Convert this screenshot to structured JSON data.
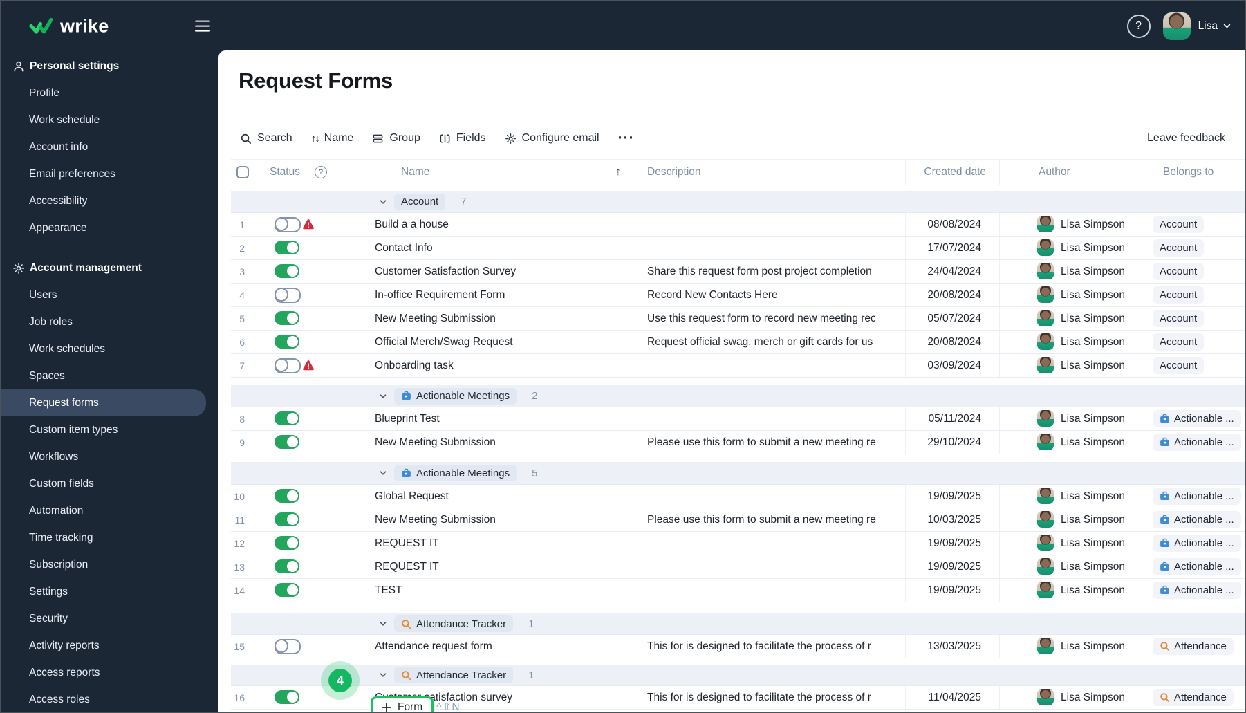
{
  "topbar": {
    "logo_text": "wrike",
    "help_glyph": "?",
    "user_name": "Lisa"
  },
  "sidebar": {
    "sections": [
      {
        "label": "Personal settings",
        "icon": "person",
        "items": [
          "Profile",
          "Work schedule",
          "Account info",
          "Email preferences",
          "Accessibility",
          "Appearance"
        ],
        "selected": null
      },
      {
        "label": "Account management",
        "icon": "gear",
        "items": [
          "Users",
          "Job roles",
          "Work schedules",
          "Spaces",
          "Request forms",
          "Custom item types",
          "Workflows",
          "Custom fields",
          "Automation",
          "Time tracking",
          "Subscription",
          "Settings",
          "Security",
          "Activity reports",
          "Access reports",
          "Access roles"
        ],
        "selected": "Request forms"
      }
    ]
  },
  "page": {
    "title": "Request Forms"
  },
  "toolbar": {
    "search_label": "Search",
    "sort_label": "Name",
    "group_label": "Group",
    "fields_label": "Fields",
    "configure_email_label": "Configure email",
    "more_label": "···",
    "leave_feedback_label": "Leave feedback",
    "sort_glyph": "↑↓"
  },
  "table": {
    "headers": {
      "status": "Status",
      "status_help": "?",
      "name": "Name",
      "description": "Description",
      "created": "Created date",
      "author": "Author",
      "belongs": "Belongs to"
    },
    "groups": [
      {
        "label": "Account",
        "count": "7",
        "icon": null,
        "rows": [
          {
            "num": "1",
            "toggle": "off",
            "warning": true,
            "name": "Build a a house",
            "description": "",
            "date": "08/08/2024",
            "author": "Lisa Simpson",
            "belongs": {
              "label": "Account",
              "icon": null
            }
          },
          {
            "num": "2",
            "toggle": "on",
            "warning": false,
            "name": "Contact Info",
            "description": "",
            "date": "17/07/2024",
            "author": "Lisa Simpson",
            "belongs": {
              "label": "Account",
              "icon": null
            }
          },
          {
            "num": "3",
            "toggle": "on",
            "warning": false,
            "name": "Customer Satisfaction Survey",
            "description": "Share this request form post project completion",
            "date": "24/04/2024",
            "author": "Lisa Simpson",
            "belongs": {
              "label": "Account",
              "icon": null
            }
          },
          {
            "num": "4",
            "toggle": "off",
            "warning": false,
            "name": "In-office Requirement Form",
            "description": "Record New Contacts Here",
            "date": "20/08/2024",
            "author": "Lisa Simpson",
            "belongs": {
              "label": "Account",
              "icon": null
            }
          },
          {
            "num": "5",
            "toggle": "on",
            "warning": false,
            "name": "New Meeting Submission",
            "description": "Use this request form to record new meeting rec",
            "date": "05/07/2024",
            "author": "Lisa Simpson",
            "belongs": {
              "label": "Account",
              "icon": null
            }
          },
          {
            "num": "6",
            "toggle": "on",
            "warning": false,
            "name": "Official Merch/Swag Request",
            "description": "Request official swag, merch or gift cards for us",
            "date": "20/08/2024",
            "author": "Lisa Simpson",
            "belongs": {
              "label": "Account",
              "icon": null
            }
          },
          {
            "num": "7",
            "toggle": "off",
            "warning": true,
            "name": "Onboarding task",
            "description": "",
            "date": "03/09/2024",
            "author": "Lisa Simpson",
            "belongs": {
              "label": "Account",
              "icon": null
            }
          }
        ]
      },
      {
        "label": "Actionable Meetings",
        "count": "2",
        "icon": "briefcase",
        "rows": [
          {
            "num": "8",
            "toggle": "on",
            "warning": false,
            "name": "Blueprint Test",
            "description": "",
            "date": "05/11/2024",
            "author": "Lisa Simpson",
            "belongs": {
              "label": "Actionable ...",
              "icon": "briefcase"
            }
          },
          {
            "num": "9",
            "toggle": "on",
            "warning": false,
            "name": "New Meeting Submission",
            "description": "Please use this form to submit a new meeting re",
            "date": "29/10/2024",
            "author": "Lisa Simpson",
            "belongs": {
              "label": "Actionable ...",
              "icon": "briefcase"
            }
          }
        ]
      },
      {
        "label": "Actionable Meetings",
        "count": "5",
        "icon": "briefcase",
        "rows": [
          {
            "num": "10",
            "toggle": "on",
            "warning": false,
            "name": "Global Request",
            "description": "",
            "date": "19/09/2025",
            "author": "Lisa Simpson",
            "belongs": {
              "label": "Actionable ...",
              "icon": "briefcase"
            }
          },
          {
            "num": "11",
            "toggle": "on",
            "warning": false,
            "name": "New Meeting Submission",
            "description": "Please use this form to submit a new meeting re",
            "date": "10/03/2025",
            "author": "Lisa Simpson",
            "belongs": {
              "label": "Actionable ...",
              "icon": "briefcase"
            }
          },
          {
            "num": "12",
            "toggle": "on",
            "warning": false,
            "name": "REQUEST IT",
            "description": "",
            "date": "19/09/2025",
            "author": "Lisa Simpson",
            "belongs": {
              "label": "Actionable ...",
              "icon": "briefcase"
            }
          },
          {
            "num": "13",
            "toggle": "on",
            "warning": false,
            "name": "REQUEST IT",
            "description": "",
            "date": "19/09/2025",
            "author": "Lisa Simpson",
            "belongs": {
              "label": "Actionable ...",
              "icon": "briefcase"
            }
          },
          {
            "num": "14",
            "toggle": "on",
            "warning": false,
            "name": "TEST",
            "description": "",
            "date": "19/09/2025",
            "author": "Lisa Simpson",
            "belongs": {
              "label": "Actionable ...",
              "icon": "briefcase"
            }
          }
        ]
      },
      {
        "label": "Attendance Tracker",
        "count": "1",
        "icon": "magnifier",
        "rows": [
          {
            "num": "15",
            "toggle": "off",
            "warning": false,
            "name": "Attendance request form",
            "description": "This for is designed to facilitate the process of r",
            "date": "13/03/2025",
            "author": "Lisa Simpson",
            "belongs": {
              "label": "Attendance",
              "icon": "magnifier"
            }
          }
        ]
      },
      {
        "label": "Attendance Tracker",
        "count": "1",
        "icon": "magnifier",
        "rows": [
          {
            "num": "16",
            "toggle": "on",
            "warning": false,
            "name": "Customer satisfaction survey",
            "description": "This for is designed to facilitate the process of r",
            "date": "11/04/2025",
            "author": "Lisa Simpson",
            "belongs": {
              "label": "Attendance",
              "icon": "magnifier"
            }
          }
        ]
      }
    ]
  },
  "footer": {
    "marker_count": "4",
    "form_label": "Form",
    "shortcut_hint": "^⇧N"
  },
  "colors": {
    "topbar_bg": "#1c2736",
    "selected_item_bg": "#3a4a63",
    "accent_green": "#17c35f",
    "toggle_on_green": "#23a55e",
    "warning_red": "#d6293a",
    "briefcase_blue": "#3f8cd6",
    "magnifier_orange": "#e2882f",
    "group_band_bg": "#edf1f7"
  }
}
